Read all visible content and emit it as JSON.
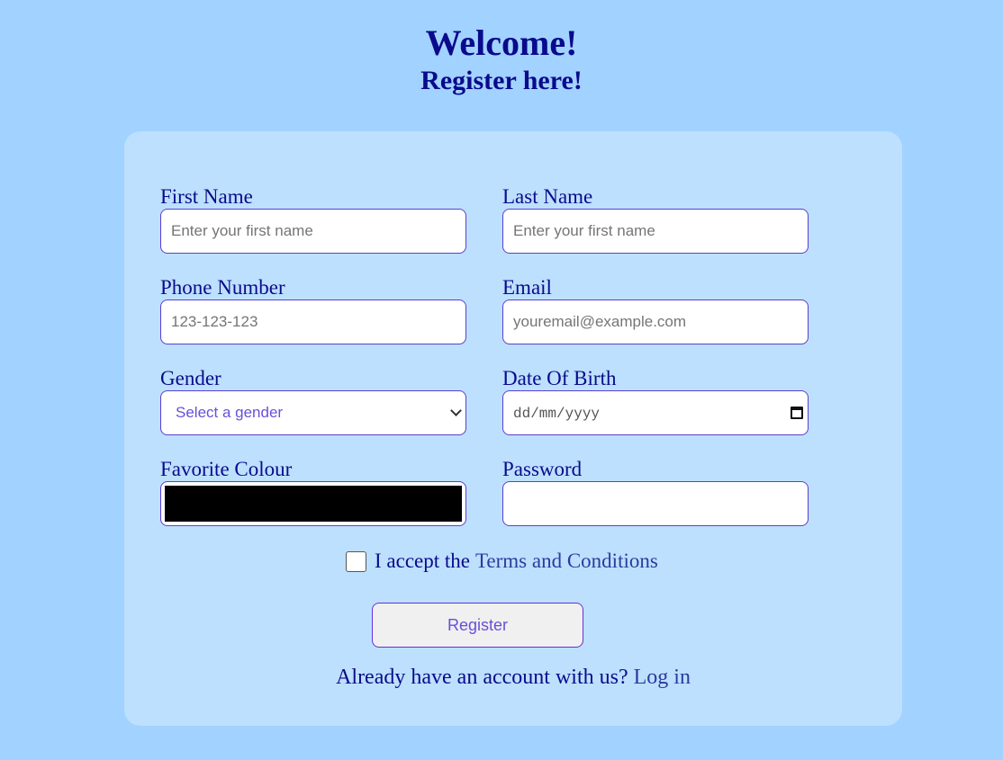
{
  "header": {
    "title": "Welcome!",
    "subtitle": "Register here!"
  },
  "form": {
    "first_name": {
      "label": "First Name",
      "placeholder": "Enter your first name",
      "value": ""
    },
    "last_name": {
      "label": "Last Name",
      "placeholder": "Enter your first name",
      "value": ""
    },
    "phone": {
      "label": "Phone Number",
      "placeholder": "123-123-123",
      "value": ""
    },
    "email": {
      "label": "Email",
      "placeholder": "youremail@example.com",
      "value": ""
    },
    "gender": {
      "label": "Gender",
      "selected": "Select a gender"
    },
    "dob": {
      "label": "Date Of Birth",
      "placeholder": "dd/mm/yyyy"
    },
    "favorite_colour": {
      "label": "Favorite Colour",
      "value": "#000000"
    },
    "password": {
      "label": "Password",
      "value": ""
    }
  },
  "terms": {
    "checked": false,
    "prefix": "I accept the",
    "link": "Terms and Conditions"
  },
  "register_label": "Register",
  "login": {
    "prefix": "Already have an account with us?",
    "link": "Log in"
  },
  "colors": {
    "page_background": "#a2d2ff",
    "card_background": "#bde0fe",
    "text": "#0a0a8c",
    "accent": "#5a3fd0"
  },
  "icons": {
    "gender_select": "chevron-down-icon",
    "dob_picker": "calendar-icon"
  }
}
